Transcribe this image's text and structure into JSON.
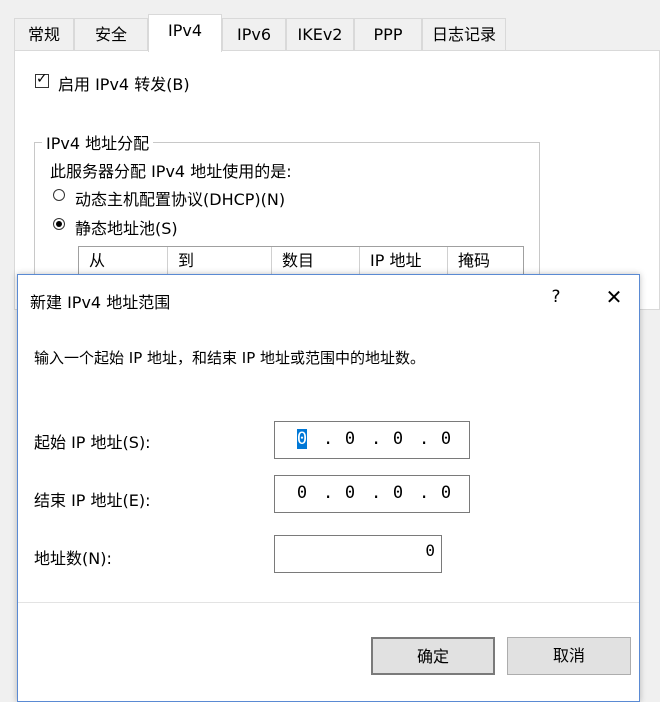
{
  "tabs": [
    {
      "label": "常规"
    },
    {
      "label": "安全"
    },
    {
      "label": "IPv4"
    },
    {
      "label": "IPv6"
    },
    {
      "label": "IKEv2"
    },
    {
      "label": "PPP"
    },
    {
      "label": "日志记录"
    }
  ],
  "ipv4_panel": {
    "enable_forwarding_label": "启用 IPv4 转发(B)",
    "group_title": "IPv4 地址分配",
    "group_desc": "此服务器分配 IPv4 地址使用的是:",
    "dhcp_label": "动态主机配置协议(DHCP)(N)",
    "static_label": "静态地址池(S)",
    "columns": [
      "从",
      "到",
      "数目",
      "IP 地址",
      "掩码"
    ]
  },
  "dialog": {
    "title": "新建 IPv4 地址范围",
    "help_glyph": "?",
    "close_glyph": "✕",
    "instruction": "输入一个起始 IP 地址，和结束 IP 地址或范围中的地址数。",
    "start_label": "起始 IP 地址(S):",
    "start_octets": [
      "0",
      "0",
      "0",
      "0"
    ],
    "end_label": "结束 IP 地址(E):",
    "end_octets": [
      "0",
      "0",
      "0",
      "0"
    ],
    "count_label": "地址数(N):",
    "count_value": "0",
    "ok_label": "确定",
    "cancel_label": "取消"
  }
}
